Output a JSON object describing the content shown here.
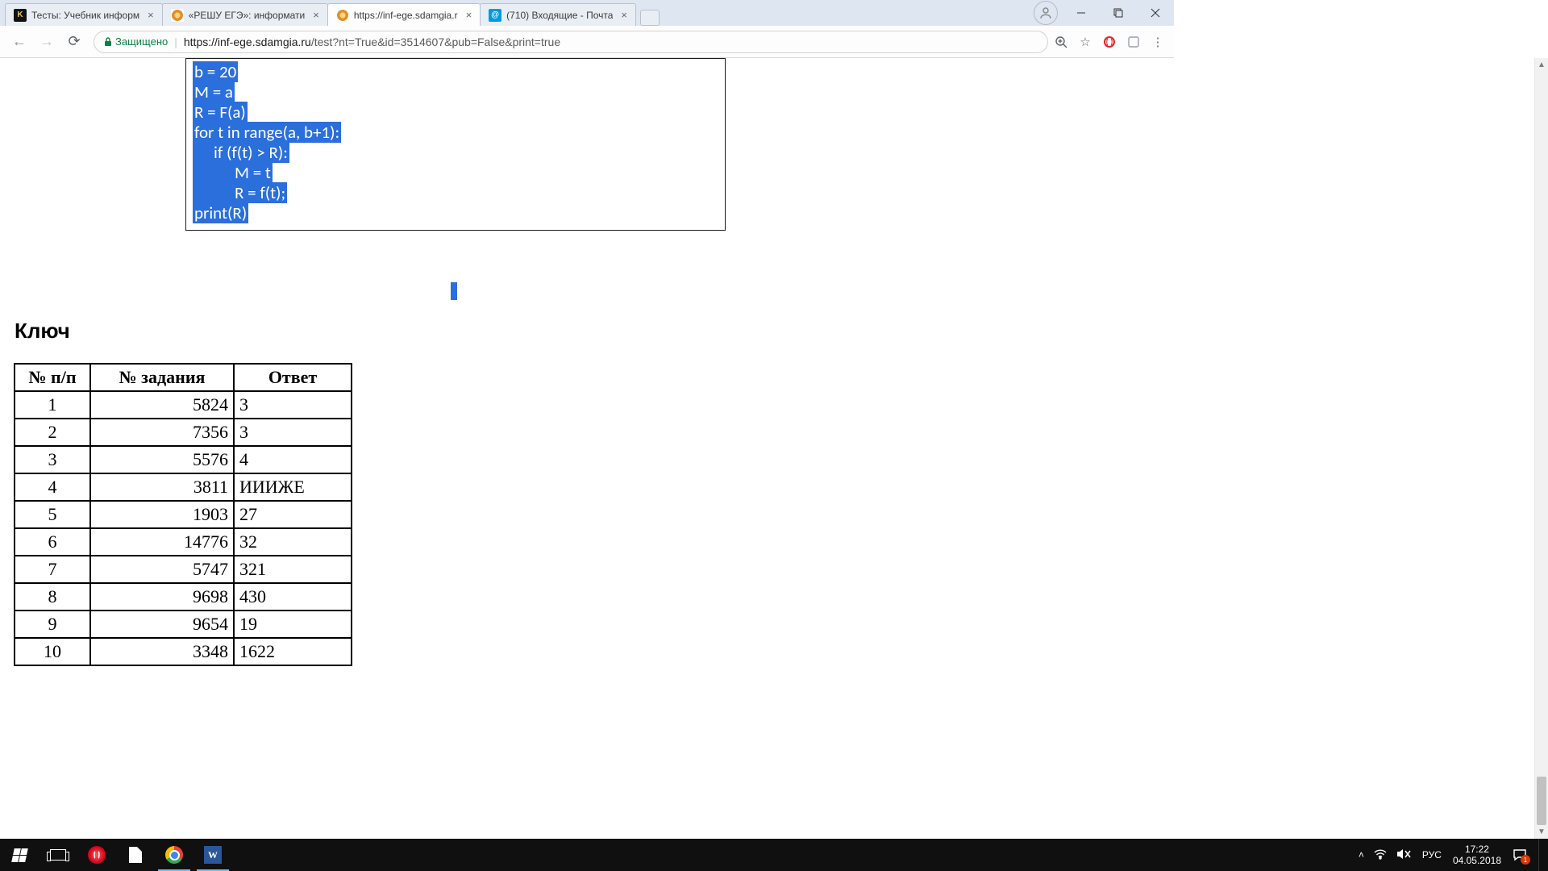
{
  "browser": {
    "tabs": [
      {
        "title": "Тесты: Учебник информ"
      },
      {
        "title": "«РЕШУ ЕГЭ»: информати"
      },
      {
        "title": "https://inf-ege.sdamgia.r"
      },
      {
        "title": "(710) Входящие - Почта"
      }
    ],
    "secure_label": "Защищено",
    "url_host": "https://inf-ege.sdamgia.ru",
    "url_path": "/test?nt=True&id=3514607&pub=False&print=true"
  },
  "code": {
    "lines": [
      "b = 20",
      "M = a",
      "R = F(a)",
      "for t in range(a, b+1):",
      "if (f(t) > R):",
      "M = t",
      "R = f(t);",
      "print(R)"
    ]
  },
  "page": {
    "key_header": "Ключ",
    "table": {
      "headers": [
        "№ п/п",
        "№ задания",
        "Ответ"
      ],
      "rows": [
        [
          "1",
          "5824",
          "3"
        ],
        [
          "2",
          "7356",
          "3"
        ],
        [
          "3",
          "5576",
          "4"
        ],
        [
          "4",
          "3811",
          "ИИИЖЕ"
        ],
        [
          "5",
          "1903",
          "27"
        ],
        [
          "6",
          "14776",
          "32"
        ],
        [
          "7",
          "5747",
          "321"
        ],
        [
          "8",
          "9698",
          "430"
        ],
        [
          "9",
          "9654",
          "19"
        ],
        [
          "10",
          "3348",
          "1622"
        ]
      ]
    }
  },
  "system": {
    "language": "РУС",
    "time": "17:22",
    "date": "04.05.2018",
    "notifications": "1"
  }
}
